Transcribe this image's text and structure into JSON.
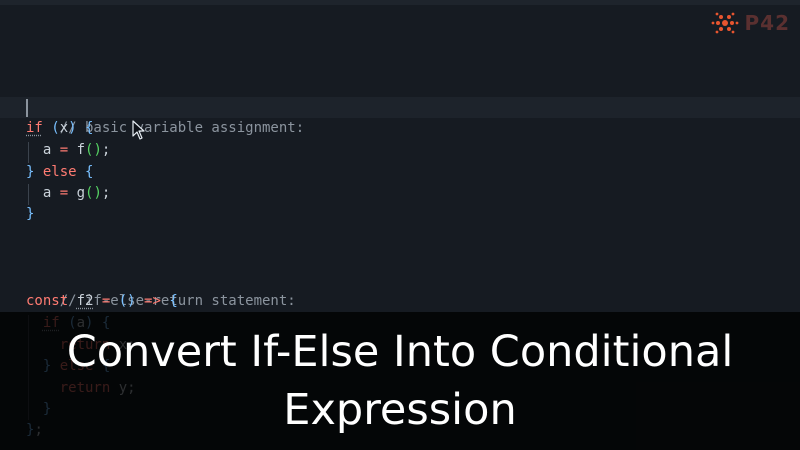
{
  "logo": {
    "text": "P42",
    "accent_color": "#e8552f"
  },
  "code": {
    "comment1": "// basic variable assignment:",
    "comment2": "// if-else-return statement:",
    "tokens": {
      "if": "if",
      "x": "x",
      "a": "a",
      "f": "f",
      "g": "g",
      "else": "else",
      "const": "const",
      "f2": "f2",
      "cond_a": "a",
      "return": "return",
      "ret_x": "x",
      "ret_y": "y"
    }
  },
  "title": {
    "line1": "Convert If-Else Into Conditional",
    "line2": "Expression"
  }
}
